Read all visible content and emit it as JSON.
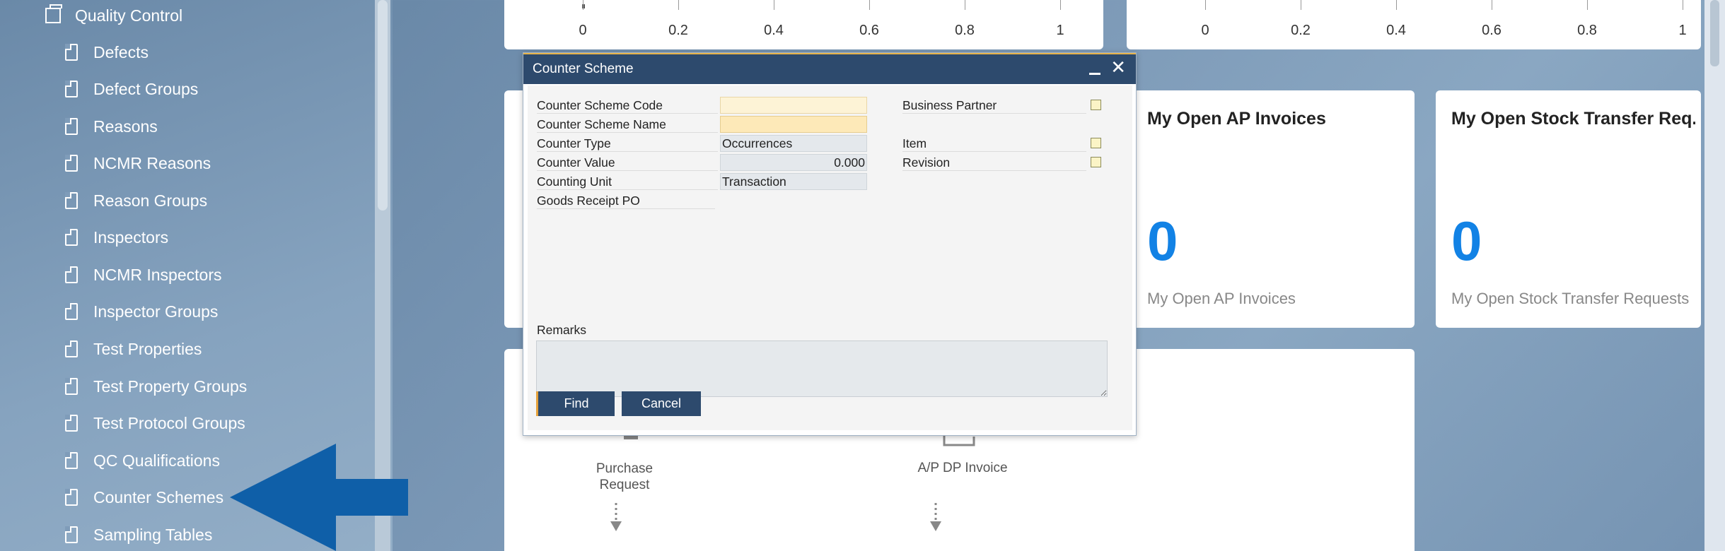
{
  "sidebar": {
    "group_label": "Quality Control",
    "items": [
      {
        "label": "Defects"
      },
      {
        "label": "Defect Groups"
      },
      {
        "label": "Reasons"
      },
      {
        "label": "NCMR Reasons"
      },
      {
        "label": "Reason Groups"
      },
      {
        "label": "Inspectors"
      },
      {
        "label": "NCMR Inspectors"
      },
      {
        "label": "Inspector Groups"
      },
      {
        "label": "Test Properties"
      },
      {
        "label": "Test Property Groups"
      },
      {
        "label": "Test Protocol Groups"
      },
      {
        "label": "QC Qualifications"
      },
      {
        "label": "Counter Schemes"
      },
      {
        "label": "Sampling Tables"
      }
    ]
  },
  "charts": {
    "left_ticks": [
      "0",
      "0.2",
      "0.4",
      "0.6",
      "0.8",
      "1"
    ],
    "right_ticks": [
      "0",
      "0.2",
      "0.4",
      "0.6",
      "0.8",
      "1"
    ]
  },
  "cards": {
    "ap_invoices": {
      "title": "My Open AP Invoices",
      "count": "0",
      "subtitle": "My Open AP Invoices"
    },
    "stock_transfer": {
      "title": "My Open Stock Transfer Req...",
      "count": "0",
      "subtitle": "My Open Stock Transfer Requests"
    }
  },
  "flow": {
    "purchase_request": "Purchase\nRequest",
    "ap_dp_invoice": "A/P DP Invoice"
  },
  "dialog": {
    "title": "Counter Scheme",
    "fields": {
      "code_label": "Counter Scheme Code",
      "code_value": "",
      "name_label": "Counter Scheme Name",
      "name_value": "",
      "type_label": "Counter Type",
      "type_value": "Occurrences",
      "value_label": "Counter Value",
      "value_value": "0.000",
      "unit_label": "Counting Unit",
      "unit_value": "Transaction",
      "grpo_label": "Goods Receipt PO",
      "bp_label": "Business Partner",
      "item_label": "Item",
      "revision_label": "Revision",
      "remarks_label": "Remarks",
      "remarks_value": ""
    },
    "buttons": {
      "find": "Find",
      "cancel": "Cancel"
    }
  },
  "colors": {
    "accent": "#2d4a6d",
    "count_blue": "#1282e5",
    "arrow_blue": "#0f5fa8"
  }
}
